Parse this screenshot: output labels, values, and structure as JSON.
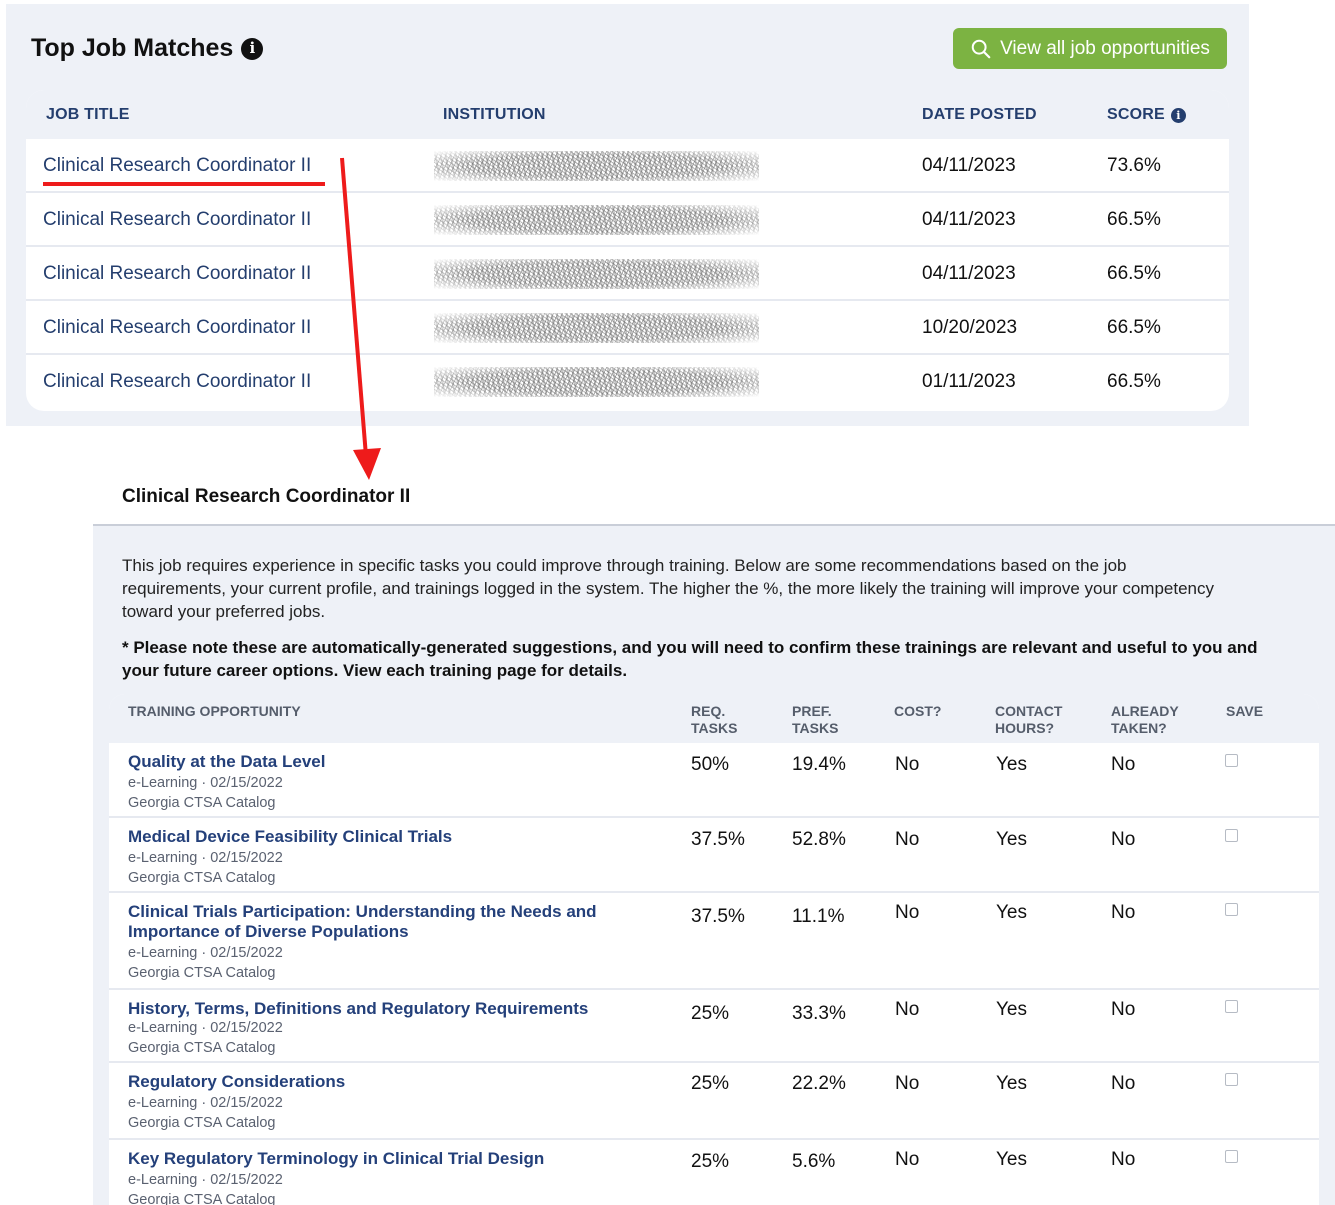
{
  "top": {
    "title": "Top Job Matches",
    "info_icon": "i",
    "view_all_label": "View all job opportunities",
    "columns": {
      "job_title": "JOB TITLE",
      "institution": "INSTITUTION",
      "date_posted": "DATE POSTED",
      "score": "SCORE"
    },
    "rows": [
      {
        "title": "Clinical Research Coordinator II",
        "date": "04/11/2023",
        "score": "73.6%"
      },
      {
        "title": "Clinical Research Coordinator II",
        "date": "04/11/2023",
        "score": "66.5%"
      },
      {
        "title": "Clinical Research Coordinator II",
        "date": "04/11/2023",
        "score": "66.5%"
      },
      {
        "title": "Clinical Research Coordinator II",
        "date": "10/20/2023",
        "score": "66.5%"
      },
      {
        "title": "Clinical Research Coordinator II",
        "date": "01/11/2023",
        "score": "66.5%"
      }
    ]
  },
  "detail": {
    "title": "Clinical Research Coordinator II",
    "intro": "This job requires experience in specific tasks you could improve through training. Below are some recommendations based on the job requirements, your current profile, and trainings logged in the system. The higher the %, the more likely the training will improve your competency toward your preferred jobs.",
    "note": "* Please note these are automatically-generated suggestions, and you will need to confirm these trainings are relevant and useful to you and your future career options. View each training page for details.",
    "columns": {
      "opportunity": "TRAINING OPPORTUNITY",
      "req_1": "REQ.",
      "req_2": "TASKS",
      "pref_1": "PREF.",
      "pref_2": "TASKS",
      "cost": "COST?",
      "contact_1": "CONTACT",
      "contact_2": "HOURS?",
      "taken_1": "ALREADY",
      "taken_2": "TAKEN?",
      "save": "SAVE"
    },
    "rows": [
      {
        "title": "Quality at the Data Level",
        "meta": "e-Learning · 02/15/2022",
        "catalog": "Georgia CTSA Catalog",
        "req": "50%",
        "pref": "19.4%",
        "cost": "No",
        "contact": "Yes",
        "taken": "No"
      },
      {
        "title": "Medical Device Feasibility Clinical Trials",
        "meta": "e-Learning · 02/15/2022",
        "catalog": "Georgia CTSA Catalog",
        "req": "37.5%",
        "pref": "52.8%",
        "cost": "No",
        "contact": "Yes",
        "taken": "No"
      },
      {
        "title": "Clinical Trials Participation: Understanding the Needs and Importance of Diverse Populations",
        "meta": "e-Learning · 02/15/2022",
        "catalog": "Georgia CTSA Catalog",
        "req": "37.5%",
        "pref": "11.1%",
        "cost": "No",
        "contact": "Yes",
        "taken": "No"
      },
      {
        "title": "History, Terms, Definitions and Regulatory Requirements",
        "meta": "e-Learning · 02/15/2022",
        "catalog": "Georgia CTSA Catalog",
        "req": "25%",
        "pref": "33.3%",
        "cost": "No",
        "contact": "Yes",
        "taken": "No"
      },
      {
        "title": "Regulatory Considerations",
        "meta": "e-Learning · 02/15/2022",
        "catalog": "Georgia CTSA Catalog",
        "req": "25%",
        "pref": "22.2%",
        "cost": "No",
        "contact": "Yes",
        "taken": "No"
      },
      {
        "title": "Key Regulatory Terminology in Clinical Trial Design",
        "meta": "e-Learning · 02/15/2022",
        "catalog": "Georgia CTSA Catalog",
        "req": "25%",
        "pref": "5.6%",
        "cost": "No",
        "contact": "Yes",
        "taken": "No"
      }
    ]
  },
  "colors": {
    "accent_green": "#7cb342",
    "link_navy": "#243e6e",
    "annotation_red": "#ee1b1b",
    "panel_bg": "#eef1f7"
  }
}
